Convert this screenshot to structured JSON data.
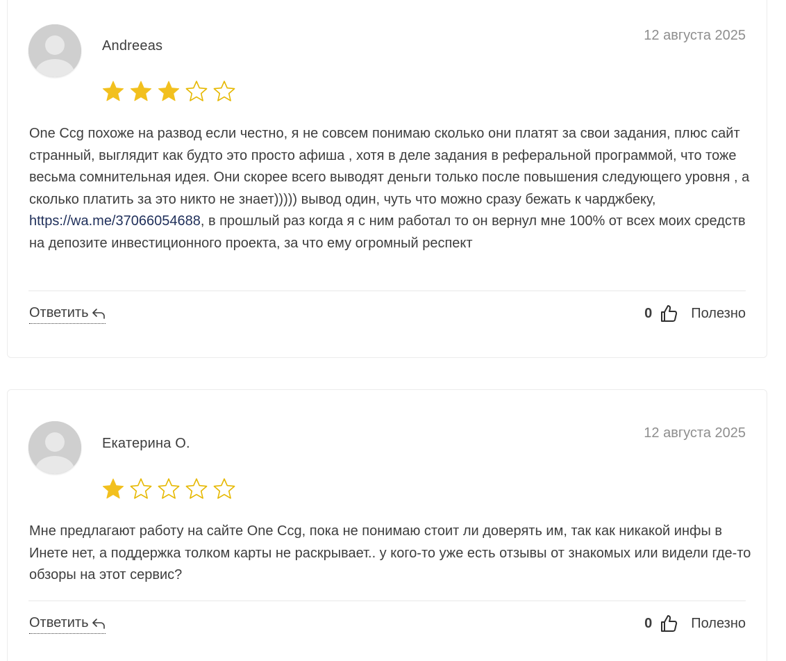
{
  "reviews": [
    {
      "author": "Andreeas",
      "date": "12 августа 2025",
      "rating": 3,
      "max_rating": 5,
      "text_before_link": "One Ccg похоже на развод если честно, я не совсем понимаю сколько они платят за свои задания, плюс сайт странный, выглядит как будто это просто афиша , хотя в деле задания в реферальной программой, что тоже весьма сомнительная идея. Они скорее всего выводят деньги только после повышения следующего уровня , а сколько платить за это никто не знает))))) вывод один, чуть что можно сразу бежать к чарджбеку, ",
      "link_text": "https://wa.me/37066054688",
      "text_after_link": ", в прошлый раз когда я с ним работал то он вернул мне 100% от всех моих средств на депозите инвестиционного проекта, за что ему огромный респект",
      "reply_label": "Ответить",
      "helpful_count": "0",
      "helpful_label": "Полезно"
    },
    {
      "author": "Екатерина О.",
      "date": "12 августа 2025",
      "rating": 1,
      "max_rating": 5,
      "text": "Мне предлагают работу на сайте One Ccg, пока не понимаю стоит ли доверять им, так как никакой инфы в Инете нет, а поддержка толком карты не раскрывает.. у кого-то уже есть отзывы от знакомых или видели где-то обзоры на этот сервис?",
      "reply_label": "Ответить",
      "helpful_count": "0",
      "helpful_label": "Полезно"
    }
  ],
  "colors": {
    "star_filled": "#f2c01e",
    "star_empty_stroke": "#e6b800",
    "date": "#8e8e8e",
    "text": "#3d3d3d",
    "link": "#1f2f5a"
  },
  "icons": {
    "avatar": "user-avatar-placeholder",
    "star": "star-icon",
    "reply": "reply-arrow-icon",
    "thumb": "thumbs-up-icon"
  }
}
